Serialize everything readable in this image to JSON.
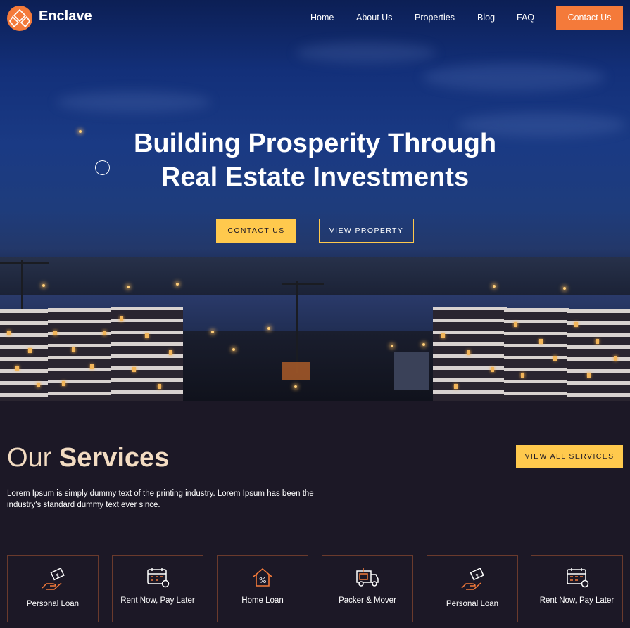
{
  "brand": {
    "name": "Enclave",
    "color": "#f47a3a"
  },
  "nav": {
    "links": [
      "Home",
      "About Us",
      "Properties",
      "Blog",
      "FAQ"
    ],
    "cta": "Contact Us"
  },
  "hero": {
    "title_line1": "Building Prosperity Through",
    "title_line2": "Real Estate Investments",
    "primary_button": "CONTACT US",
    "secondary_button": "VIEW PROPERTY"
  },
  "services": {
    "heading_light": "Our",
    "heading_bold": "Services",
    "description": "Lorem Ipsum is simply dummy text of the printing industry. Lorem Ipsum has been the industry's standard dummy text ever since.",
    "view_all": "VIEW ALL SERVICES",
    "cards": [
      {
        "label": "Personal Loan",
        "icon": "hand-money-icon"
      },
      {
        "label": "Rent Now, Pay Later",
        "icon": "calendar-payment-icon"
      },
      {
        "label": "Home Loan",
        "icon": "house-percent-icon"
      },
      {
        "label": "Packer & Mover",
        "icon": "moving-truck-icon"
      },
      {
        "label": "Personal Loan",
        "icon": "hand-money-icon"
      },
      {
        "label": "Rent Now, Pay Later",
        "icon": "calendar-payment-icon"
      }
    ]
  },
  "colors": {
    "accent": "#ffc94d",
    "background": "#1c1826",
    "heading": "#f3dcc2"
  }
}
